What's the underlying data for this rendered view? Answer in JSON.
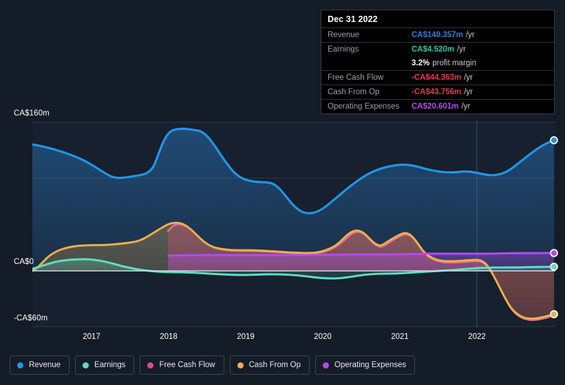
{
  "theme": {
    "background": "#141c27",
    "plot_background": "#16202e",
    "gridline": "#2c3a4c",
    "zero_line": "#d8dce0",
    "axis_text": "#ffffff"
  },
  "tooltip": {
    "date": "Dec 31 2022",
    "rows": [
      {
        "name": "Revenue",
        "value": "CA$140.357m",
        "unit": "/yr",
        "color": "#2f7ed8"
      },
      {
        "name": "Earnings",
        "value": "CA$4.520m",
        "unit": "/yr",
        "color": "#25c7a6"
      },
      {
        "name": "",
        "value": "3.2%",
        "unit": "",
        "sub": "profit margin",
        "color": "#ffffff"
      },
      {
        "name": "Free Cash Flow",
        "value": "-CA$44.363m",
        "unit": "/yr",
        "color": "#e8394a"
      },
      {
        "name": "Cash From Op",
        "value": "-CA$43.756m",
        "unit": "/yr",
        "color": "#e8394a"
      },
      {
        "name": "Operating Expenses",
        "value": "CA$20.601m",
        "unit": "/yr",
        "color": "#b44bf0"
      }
    ]
  },
  "legend": {
    "items": [
      {
        "label": "Revenue",
        "color": "#2196e8"
      },
      {
        "label": "Earnings",
        "color": "#5de0c0"
      },
      {
        "label": "Free Cash Flow",
        "color": "#e0507e"
      },
      {
        "label": "Cash From Op",
        "color": "#efae4a"
      },
      {
        "label": "Operating Expenses",
        "color": "#b44bf0"
      }
    ]
  },
  "chart_data": {
    "type": "area",
    "title": "",
    "xlabel": "",
    "ylabel": "CA$",
    "currency": "CA$",
    "unit": "m",
    "ylim": [
      -60,
      160
    ],
    "yticks": [
      160,
      0,
      -60
    ],
    "ytick_labels": [
      "CA$160m",
      "CA$0",
      "-CA$60m"
    ],
    "unlabeled_gridlines": [
      100
    ],
    "grid": true,
    "legend_position": "bottom",
    "x": [
      2016.4,
      2017,
      2018,
      2019,
      2020,
      2021,
      2022,
      2022.9
    ],
    "xticks": [
      2017,
      2018,
      2019,
      2020,
      2021,
      2022
    ],
    "xtick_labels": [
      "2017",
      "2018",
      "2019",
      "2020",
      "2021",
      "2022"
    ],
    "forecast_divider_x": 2022,
    "series": [
      {
        "name": "Revenue",
        "color": "#2196e8",
        "fill": "rgba(33,150,232,0.16)",
        "values": [
          136,
          126,
          172,
          100,
          62,
          108,
          96,
          140.357
        ],
        "end_value": 140.357
      },
      {
        "name": "Earnings",
        "color": "#5de0c0",
        "fill": "rgba(93,224,192,0.16)",
        "values": [
          2,
          4,
          0,
          -1,
          -7,
          -3,
          1,
          4.52
        ],
        "end_value": 4.52
      },
      {
        "name": "Free Cash Flow",
        "color": "#e0507e",
        "fill": "rgba(224,80,126,0.18)",
        "values": [
          0,
          18,
          32,
          16,
          14,
          34,
          -2,
          -44.363
        ],
        "end_value": -44.363
      },
      {
        "name": "Cash From Op",
        "color": "#efae4a",
        "fill": "rgba(239,174,74,0.18)",
        "values": [
          0,
          19,
          33,
          17,
          15,
          36,
          -1,
          -43.756
        ],
        "end_value": -43.756
      },
      {
        "name": "Operating Expenses",
        "color": "#b44bf0",
        "fill": "rgba(180,75,240,0.20)",
        "values": [
          null,
          null,
          16,
          16,
          17,
          18,
          20,
          20.601
        ],
        "end_value": 20.601,
        "starts_at_x": 2018
      }
    ]
  }
}
